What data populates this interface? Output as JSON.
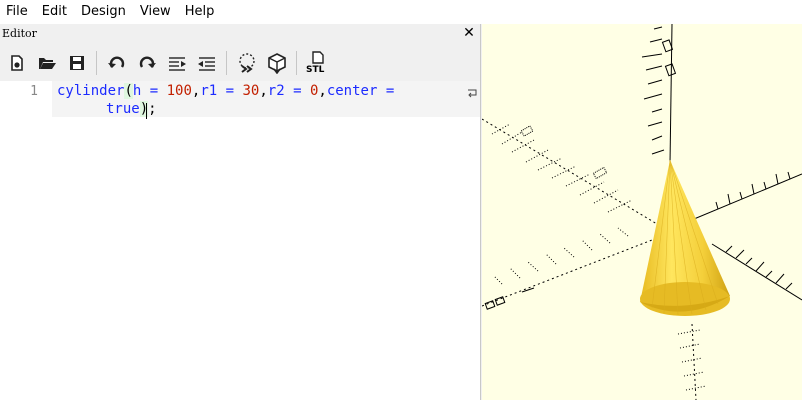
{
  "menu": {
    "items": [
      "File",
      "Edit",
      "Design",
      "View",
      "Help"
    ]
  },
  "editor": {
    "title": "Editor",
    "close_label": "✕",
    "toolbar": {
      "stl_label": "STL"
    },
    "line_number": "1",
    "code": {
      "line1": {
        "fn": "cylinder",
        "open_paren": "(",
        "p1": "h = ",
        "v1": "100",
        "c1": ",",
        "p2": "r1 = ",
        "v2": "30",
        "c2": ",",
        "p3": "r2 = ",
        "v3": "0",
        "c3": ",",
        "p4": "center = "
      },
      "line2": {
        "kw": "true",
        "close_paren": ")",
        "end": ";"
      }
    }
  },
  "colors": {
    "viewport_bg": "#ffffe5",
    "cone_light": "#ffe45c",
    "cone_mid": "#f0c530",
    "cone_dark": "#c79b10",
    "axis": "#000000"
  },
  "icons": [
    "new-file-icon",
    "open-folder-icon",
    "save-icon",
    "undo-icon",
    "redo-icon",
    "unindent-icon",
    "indent-icon",
    "preview-icon",
    "render-icon",
    "export-stl-icon",
    "close-icon",
    "line-wrap-icon"
  ]
}
